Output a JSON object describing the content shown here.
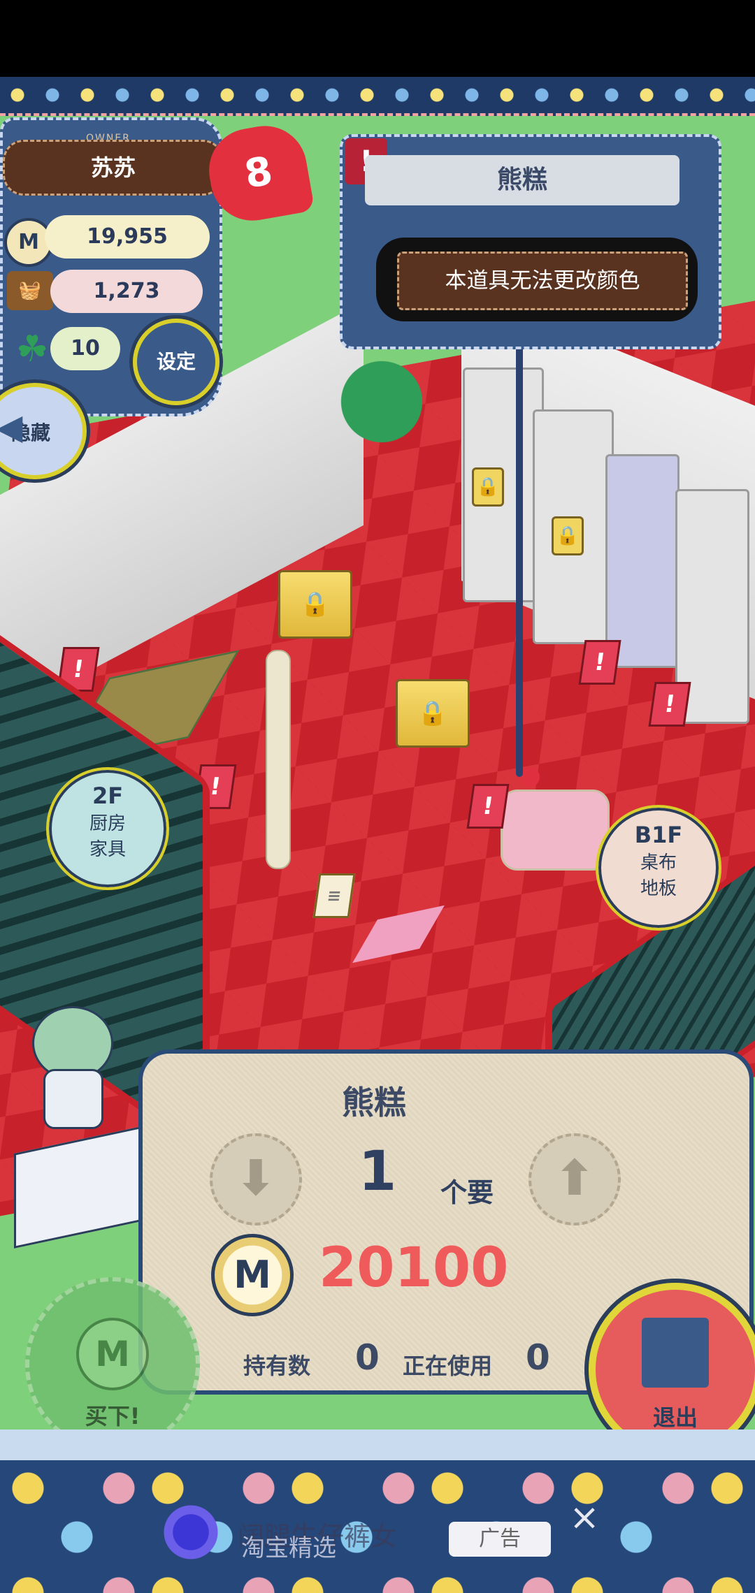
{
  "owner": {
    "tag": "OWNER",
    "name": "苏苏",
    "hearts": "8",
    "coins": "19,955",
    "ingredients": "1,273",
    "clovers": "10",
    "settings_label": "设定",
    "hide_label": "隐藏"
  },
  "item": {
    "name": "熊糕",
    "alert": "!",
    "note": "本道具无法更改颜色"
  },
  "floor_buttons": {
    "up_floor": {
      "floor": "2F",
      "line1": "厨房",
      "line2": "家具"
    },
    "down_floor": {
      "floor": "B1F",
      "line1": "桌布",
      "line2": "地板"
    }
  },
  "purchase": {
    "title": "熊糕",
    "quantity": "1",
    "quantity_unit": "个要",
    "price": "20100",
    "owned_label": "持有数",
    "owned_value": "0",
    "in_use_label": "正在使用",
    "in_use_value": "0",
    "buy_label": "买下!",
    "exit_label": "退出",
    "coin_symbol": "M"
  },
  "ad": {
    "text": "阔腿牛仔裤女",
    "subtext": "淘宝精选",
    "tag": "广告",
    "close": "×"
  },
  "colors": {
    "denim": "#3a5a8a",
    "price": "#ef5b5b",
    "accent_yellow": "#d8cf2a",
    "floor_red": "#c7222b"
  }
}
